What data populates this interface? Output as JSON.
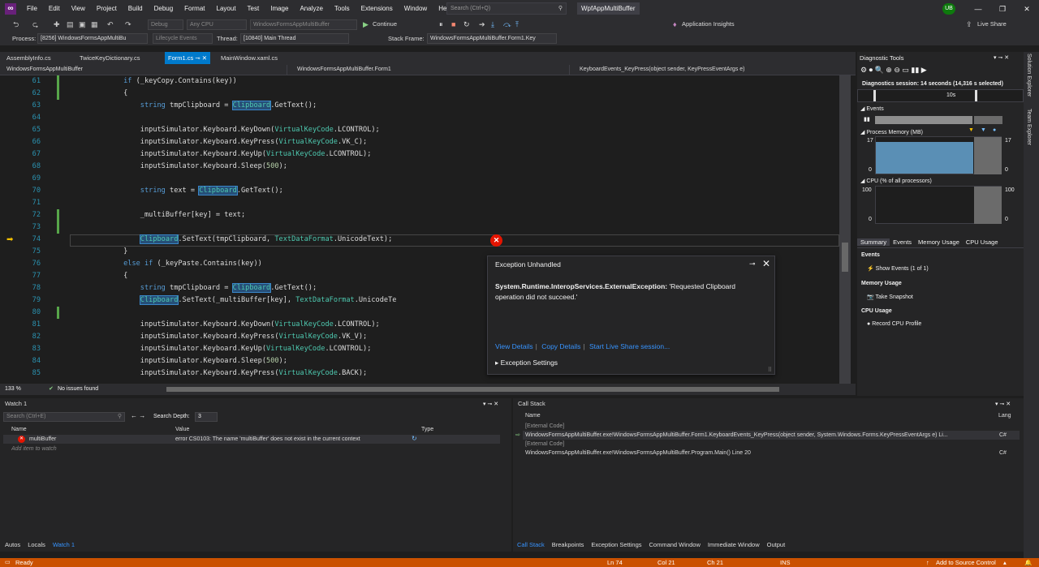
{
  "menubar": {
    "items": [
      "File",
      "Edit",
      "View",
      "Project",
      "Build",
      "Debug",
      "Format",
      "Layout",
      "Test",
      "Image",
      "Analyze",
      "Tools",
      "Extensions",
      "Window",
      "Help"
    ],
    "search_placeholder": "Search (Ctrl+Q)",
    "app_name": "WpfAppMultiBuffer",
    "avatar": "UB"
  },
  "toolbar": {
    "config": "Debug",
    "platform": "Any CPU",
    "startup": "WindowsFormsAppMultiBuffer",
    "continue_label": "Continue",
    "app_insights": "Application Insights",
    "live_share": "Live Share"
  },
  "debug_toolbar": {
    "process_label": "Process:",
    "process_value": "[8256] WindowsFormsAppMultiBu",
    "lifecycle": "Lifecycle Events",
    "thread_label": "Thread:",
    "thread_value": "[10840] Main Thread",
    "stackframe_label": "Stack Frame:",
    "stackframe_value": "WindowsFormsAppMultiBuffer.Form1.Key"
  },
  "doc_tabs": [
    "AssemblyInfo.cs",
    "TwiceKeyDictionary.cs",
    "Form1.cs",
    "MainWindow.xaml.cs"
  ],
  "nav": {
    "project": "WindowsFormsAppMultiBuffer",
    "class": "WindowsFormsAppMultiBuffer.Form1",
    "member": "KeyboardEvents_KeyPress(object sender, KeyPressEventArgs e)"
  },
  "code_lines": [
    {
      "n": "61",
      "indent": "            ",
      "parts": [
        {
          "t": "if",
          "c": "kw"
        },
        {
          "t": " (_keyCopy.Contains(key))"
        }
      ]
    },
    {
      "n": "62",
      "indent": "            ",
      "parts": [
        {
          "t": "{"
        }
      ]
    },
    {
      "n": "63",
      "indent": "                ",
      "parts": [
        {
          "t": "string",
          "c": "kw"
        },
        {
          "t": " tmpClipboard = "
        },
        {
          "t": "Clipboard",
          "c": "ty hl"
        },
        {
          "t": ".GetText();"
        }
      ]
    },
    {
      "n": "64",
      "indent": "",
      "parts": []
    },
    {
      "n": "65",
      "indent": "                ",
      "parts": [
        {
          "t": "inputSimulator.Keyboard.KeyDown("
        },
        {
          "t": "VirtualKeyCode",
          "c": "ty"
        },
        {
          "t": ".LCONTROL);"
        }
      ]
    },
    {
      "n": "66",
      "indent": "                ",
      "parts": [
        {
          "t": "inputSimulator.Keyboard.KeyPress("
        },
        {
          "t": "VirtualKeyCode",
          "c": "ty"
        },
        {
          "t": ".VK_C);"
        }
      ]
    },
    {
      "n": "67",
      "indent": "                ",
      "parts": [
        {
          "t": "inputSimulator.Keyboard.KeyUp("
        },
        {
          "t": "VirtualKeyCode",
          "c": "ty"
        },
        {
          "t": ".LCONTROL);"
        }
      ]
    },
    {
      "n": "68",
      "indent": "                ",
      "parts": [
        {
          "t": "inputSimulator.Keyboard.Sleep("
        },
        {
          "t": "500",
          "c": "nm"
        },
        {
          "t": ");"
        }
      ]
    },
    {
      "n": "69",
      "indent": "",
      "parts": []
    },
    {
      "n": "70",
      "indent": "                ",
      "parts": [
        {
          "t": "string",
          "c": "kw"
        },
        {
          "t": " text = "
        },
        {
          "t": "Clipboard",
          "c": "ty hl"
        },
        {
          "t": ".GetText();"
        }
      ]
    },
    {
      "n": "71",
      "indent": "",
      "parts": []
    },
    {
      "n": "72",
      "indent": "                ",
      "parts": [
        {
          "t": "_multiBuffer[key] = text;"
        }
      ]
    },
    {
      "n": "73",
      "indent": "",
      "parts": []
    },
    {
      "n": "74",
      "indent": "                ",
      "parts": [
        {
          "t": "Clipboard",
          "c": "ty hl"
        },
        {
          "t": ".SetText(tmpClipboard, "
        },
        {
          "t": "TextDataFormat",
          "c": "ty"
        },
        {
          "t": ".UnicodeText);"
        }
      ]
    },
    {
      "n": "75",
      "indent": "            ",
      "parts": [
        {
          "t": "}"
        }
      ]
    },
    {
      "n": "76",
      "indent": "            ",
      "parts": [
        {
          "t": "else if",
          "c": "kw"
        },
        {
          "t": " (_keyPaste.Contains(key))"
        }
      ]
    },
    {
      "n": "77",
      "indent": "            ",
      "parts": [
        {
          "t": "{"
        }
      ]
    },
    {
      "n": "78",
      "indent": "                ",
      "parts": [
        {
          "t": "string",
          "c": "kw"
        },
        {
          "t": " tmpClipboard = "
        },
        {
          "t": "Clipboard",
          "c": "ty hl"
        },
        {
          "t": ".GetText();"
        }
      ]
    },
    {
      "n": "79",
      "indent": "                ",
      "parts": [
        {
          "t": "Clipboard",
          "c": "ty hl"
        },
        {
          "t": ".SetText(_multiBuffer[key], "
        },
        {
          "t": "TextDataFormat",
          "c": "ty"
        },
        {
          "t": ".UnicodeTe"
        }
      ]
    },
    {
      "n": "80",
      "indent": "",
      "parts": []
    },
    {
      "n": "81",
      "indent": "                ",
      "parts": [
        {
          "t": "inputSimulator.Keyboard.KeyDown("
        },
        {
          "t": "VirtualKeyCode",
          "c": "ty"
        },
        {
          "t": ".LCONTROL);"
        }
      ]
    },
    {
      "n": "82",
      "indent": "                ",
      "parts": [
        {
          "t": "inputSimulator.Keyboard.KeyPress("
        },
        {
          "t": "VirtualKeyCode",
          "c": "ty"
        },
        {
          "t": ".VK_V);"
        }
      ]
    },
    {
      "n": "83",
      "indent": "                ",
      "parts": [
        {
          "t": "inputSimulator.Keyboard.KeyUp("
        },
        {
          "t": "VirtualKeyCode",
          "c": "ty"
        },
        {
          "t": ".LCONTROL);"
        }
      ]
    },
    {
      "n": "84",
      "indent": "                ",
      "parts": [
        {
          "t": "inputSimulator.Keyboard.Sleep("
        },
        {
          "t": "500",
          "c": "nm"
        },
        {
          "t": ");"
        }
      ]
    },
    {
      "n": "85",
      "indent": "                ",
      "parts": [
        {
          "t": "inputSimulator.Keyboard.KeyPress("
        },
        {
          "t": "VirtualKeyCode",
          "c": "ty"
        },
        {
          "t": ".BACK);"
        }
      ]
    }
  ],
  "editor_footer": {
    "zoom": "133 %",
    "issues": "No issues found"
  },
  "exception": {
    "title": "Exception Unhandled",
    "type": "System.Runtime.InteropServices.ExternalException:",
    "message": "'Requested Clipboard operation did not succeed.'",
    "links": [
      "View Details",
      "Copy Details",
      "Start Live Share session..."
    ],
    "settings": "Exception Settings"
  },
  "diagnostics": {
    "title": "Diagnostic Tools",
    "session": "Diagnostics session: 14 seconds (14,316 s selected)",
    "timeline_label": "10s",
    "events_label": "Events",
    "memory_label": "Process Memory (MB)",
    "memory_max": "17",
    "memory_min": "0",
    "cpu_label": "CPU (% of all processors)",
    "cpu_max": "100",
    "cpu_min": "0",
    "tabs": [
      "Summary",
      "Events",
      "Memory Usage",
      "CPU Usage"
    ],
    "events_heading": "Events",
    "show_events": "Show Events (1 of 1)",
    "memory_heading": "Memory Usage",
    "take_snapshot": "Take Snapshot",
    "cpu_heading": "CPU Usage",
    "record_cpu": "Record CPU Profile"
  },
  "sidebar": [
    "Solution Explorer",
    "Team Explorer"
  ],
  "watch": {
    "title": "Watch 1",
    "search_placeholder": "Search (Ctrl+E)",
    "depth_label": "Search Depth:",
    "depth_value": "3",
    "columns": [
      "Name",
      "Value",
      "Type"
    ],
    "row_name": "multiBuffer",
    "row_value": "error CS0103: The name 'multiBuffer' does not exist in the current context",
    "add_item": "Add item to watch",
    "tabs": [
      "Autos",
      "Locals",
      "Watch 1"
    ]
  },
  "callstack": {
    "title": "Call Stack",
    "columns": [
      "Name",
      "Lang"
    ],
    "rows": [
      {
        "name": "[External Code]",
        "lang": ""
      },
      {
        "name": "WindowsFormsAppMultiBuffer.exe!WindowsFormsAppMultiBuffer.Form1.KeyboardEvents_KeyPress(object sender, System.Windows.Forms.KeyPressEventArgs e) Li...",
        "lang": "C#"
      },
      {
        "name": "[External Code]",
        "lang": ""
      },
      {
        "name": "WindowsFormsAppMultiBuffer.exe!WindowsFormsAppMultiBuffer.Program.Main() Line 20",
        "lang": "C#"
      }
    ],
    "tabs": [
      "Call Stack",
      "Breakpoints",
      "Exception Settings",
      "Command Window",
      "Immediate Window",
      "Output"
    ]
  },
  "status": {
    "ready": "Ready",
    "ln": "Ln 74",
    "col": "Col 21",
    "ch": "Ch 21",
    "ins": "INS",
    "source_control": "Add to Source Control"
  }
}
